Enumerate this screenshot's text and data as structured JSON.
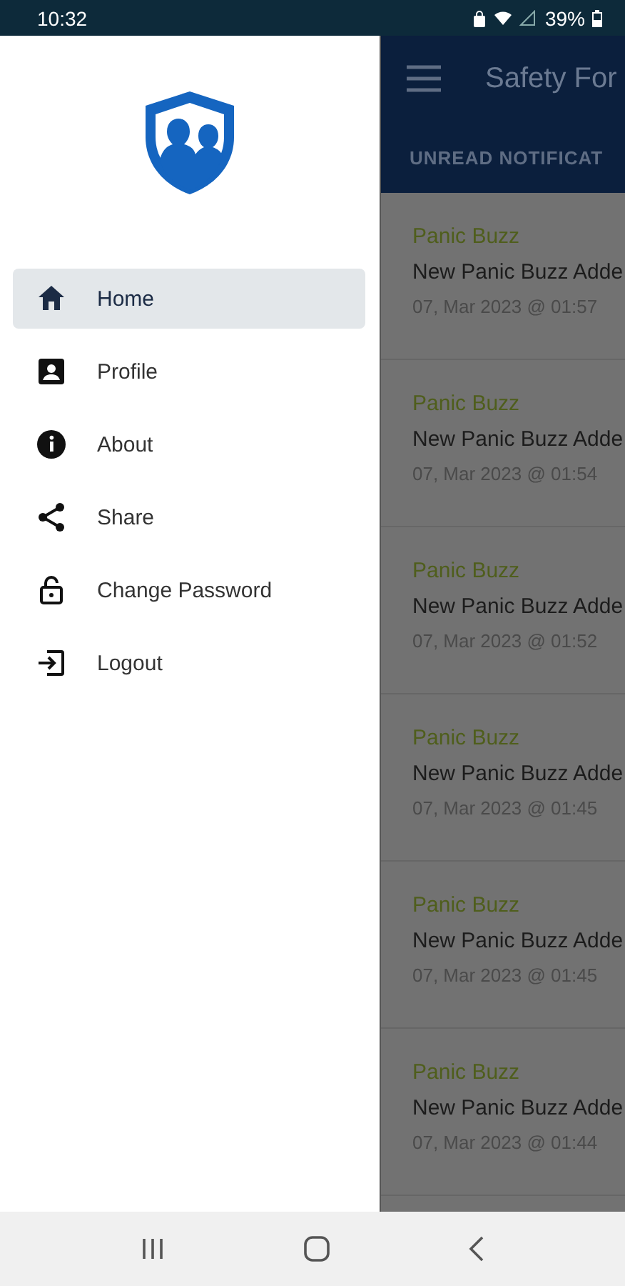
{
  "status_bar": {
    "time": "10:32",
    "battery": "39%"
  },
  "drawer": {
    "items": [
      {
        "label": "Home",
        "selected": true
      },
      {
        "label": "Profile",
        "selected": false
      },
      {
        "label": "About",
        "selected": false
      },
      {
        "label": "Share",
        "selected": false
      },
      {
        "label": "Change Password",
        "selected": false
      },
      {
        "label": "Logout",
        "selected": false
      }
    ]
  },
  "app_bar": {
    "title": "Safety For",
    "tab": "UNREAD NOTIFICAT"
  },
  "notifications": [
    {
      "category": "Panic Buzz",
      "message": "New Panic Buzz Adde",
      "time": "07, Mar 2023 @ 01:57"
    },
    {
      "category": "Panic Buzz",
      "message": "New Panic Buzz Adde",
      "time": "07, Mar 2023 @ 01:54"
    },
    {
      "category": "Panic Buzz",
      "message": "New Panic Buzz Adde",
      "time": "07, Mar 2023 @ 01:52"
    },
    {
      "category": "Panic Buzz",
      "message": "New Panic Buzz Adde",
      "time": "07, Mar 2023 @ 01:45"
    },
    {
      "category": "Panic Buzz",
      "message": "New Panic Buzz Adde",
      "time": "07, Mar 2023 @ 01:45"
    },
    {
      "category": "Panic Buzz",
      "message": "New Panic Buzz Adde",
      "time": "07, Mar 2023 @ 01:44"
    }
  ]
}
